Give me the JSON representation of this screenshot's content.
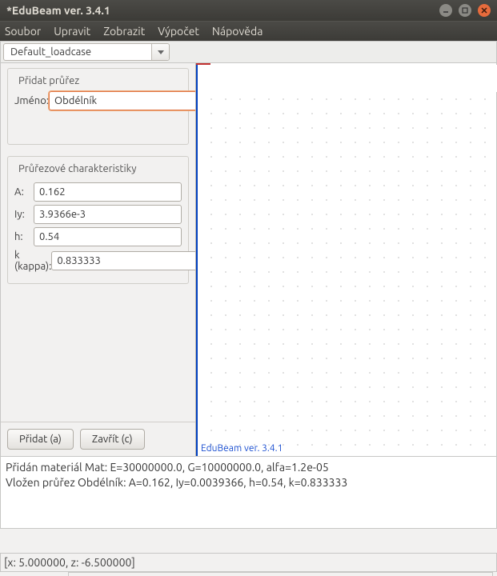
{
  "window": {
    "title": "*EduBeam ver. 3.4.1"
  },
  "menu": {
    "items": [
      "Soubor",
      "Upravit",
      "Zobrazit",
      "Výpočet",
      "Nápověda"
    ]
  },
  "toolbar": {
    "loadcase_selected": "Default_loadcase"
  },
  "panel": {
    "group_profile_title": "Přidat průřez",
    "name_label": "Jméno:",
    "name_value": "Obdélník",
    "group_chars_title": "Průřezové charakteristiky",
    "rows": {
      "A": {
        "label": "A:",
        "value": "0.162"
      },
      "Iy": {
        "label": "Iy:",
        "value": "3.9366e-3"
      },
      "h": {
        "label": "h:",
        "value": "0.54"
      },
      "k": {
        "label": "k (kappa):",
        "value": "0.833333"
      }
    },
    "add_btn": "Přidat (a)",
    "close_btn": "Zavřít (c)"
  },
  "canvas": {
    "brand": "EduBeam ver. 3.4.1"
  },
  "log": {
    "line1": "Přidán materiál Mat: E=30000000.0, G=10000000.0, alfa=1.2e-05",
    "line2": "Vložen průřez Obdélník: A=0.162, Iy=0.0039366, h=0.54, k=0.833333"
  },
  "status": {
    "coords": "[x: 5.000000, z: -6.500000]"
  }
}
